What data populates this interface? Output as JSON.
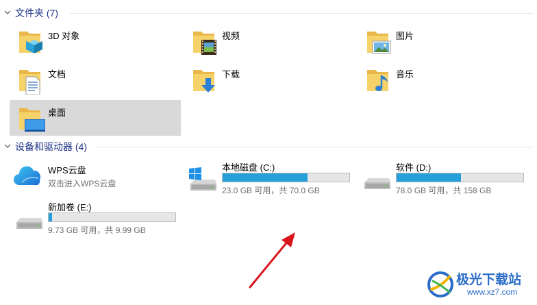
{
  "groups": {
    "folders": {
      "title": "文件夹 (7)",
      "items": [
        {
          "label": "3D 对象",
          "icon": "3d-objects-folder-icon"
        },
        {
          "label": "视频",
          "icon": "videos-folder-icon"
        },
        {
          "label": "图片",
          "icon": "pictures-folder-icon"
        },
        {
          "label": "文档",
          "icon": "documents-folder-icon"
        },
        {
          "label": "下载",
          "icon": "downloads-folder-icon"
        },
        {
          "label": "音乐",
          "icon": "music-folder-icon"
        },
        {
          "label": "桌面",
          "icon": "desktop-folder-icon",
          "selected": true
        }
      ]
    },
    "devices": {
      "title": "设备和驱动器 (4)",
      "cloud": {
        "name": "WPS云盘",
        "subtitle": "双击进入WPS云盘",
        "icon": "wps-cloud-icon"
      },
      "drives": [
        {
          "name": "本地磁盘 (C:)",
          "free": "23.0 GB 可用，共 70.0 GB",
          "used_fraction": 0.671,
          "icon": "windows-drive-icon"
        },
        {
          "name": "软件 (D:)",
          "free": "78.0 GB 可用，共 158 GB",
          "used_fraction": 0.506,
          "icon": "hard-drive-icon"
        },
        {
          "name": "新加卷 (E:)",
          "free": "9.73 GB 可用，共 9.99 GB",
          "used_fraction": 0.026,
          "icon": "hard-drive-icon"
        }
      ]
    }
  },
  "colors": {
    "group_title": "#1e3287",
    "bar_fill": "#26a0da",
    "selected_bg": "#d9d9d9",
    "annotation_arrow": "#d9161c"
  },
  "watermark": {
    "text": "极光下载站",
    "url": "www.xz7.com"
  }
}
